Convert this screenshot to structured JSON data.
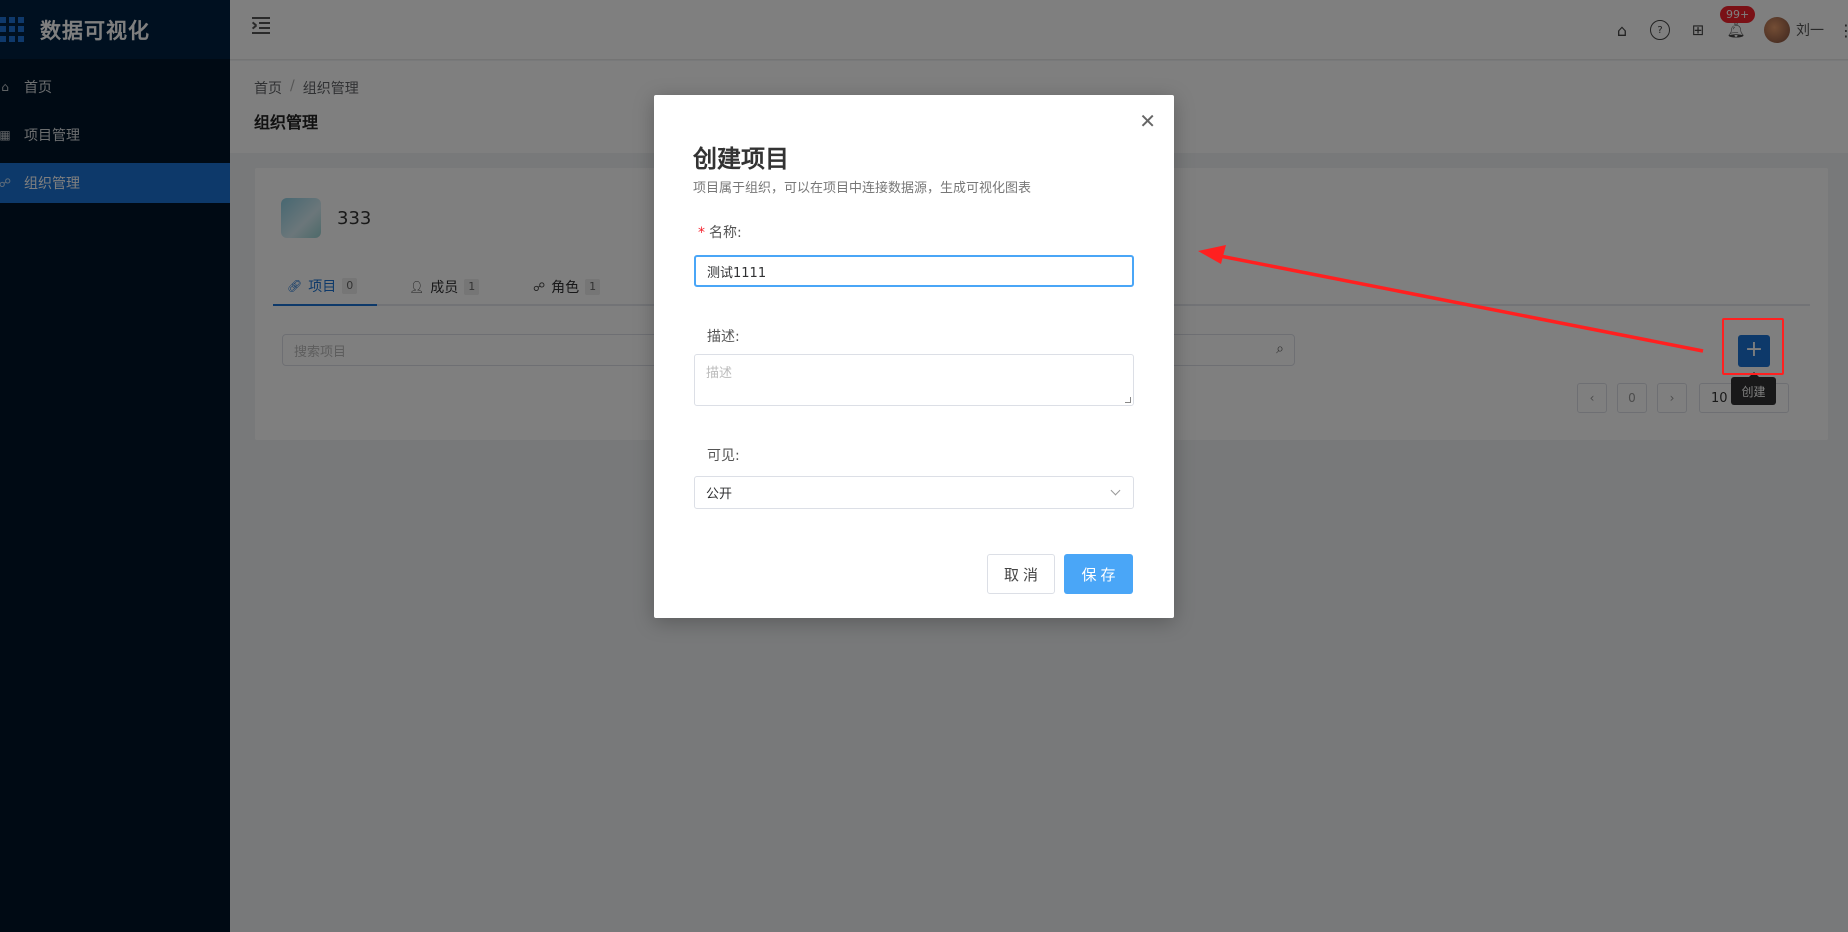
{
  "app": {
    "title": "数据可视化"
  },
  "sidebar": {
    "items": [
      {
        "label": "首页",
        "icon": "home-icon"
      },
      {
        "label": "项目管理",
        "icon": "grid-icon"
      },
      {
        "label": "组织管理",
        "icon": "team-icon",
        "active": true
      }
    ]
  },
  "header": {
    "notification_badge": "99+",
    "username": "刘一"
  },
  "breadcrumb": {
    "home": "首页",
    "separator": "/",
    "current": "组织管理"
  },
  "page": {
    "title": "组织管理"
  },
  "org": {
    "name": "333"
  },
  "tabs": [
    {
      "label": "项目",
      "count": "0",
      "active": true
    },
    {
      "label": "成员",
      "count": "1"
    },
    {
      "label": "角色",
      "count": "1"
    }
  ],
  "search": {
    "placeholder": "搜索项目"
  },
  "pager": {
    "current": "0",
    "size": "10"
  },
  "create": {
    "label": "+",
    "tooltip": "创建"
  },
  "modal": {
    "title": "创建项目",
    "subtitle": "项目属于组织，可以在项目中连接数据源，生成可视化图表",
    "name_label": "名称:",
    "name_required_mark": "*",
    "name_value": "测试1111",
    "desc_label": "描述:",
    "desc_placeholder": "描述",
    "visibility_label": "可见:",
    "visibility_value": "公开",
    "cancel": "取消",
    "save": "保存"
  },
  "colors": {
    "primary": "#1a73d4",
    "sidebar_bg": "#001529",
    "annotation": "#ff2020",
    "badge": "#f5222d"
  }
}
